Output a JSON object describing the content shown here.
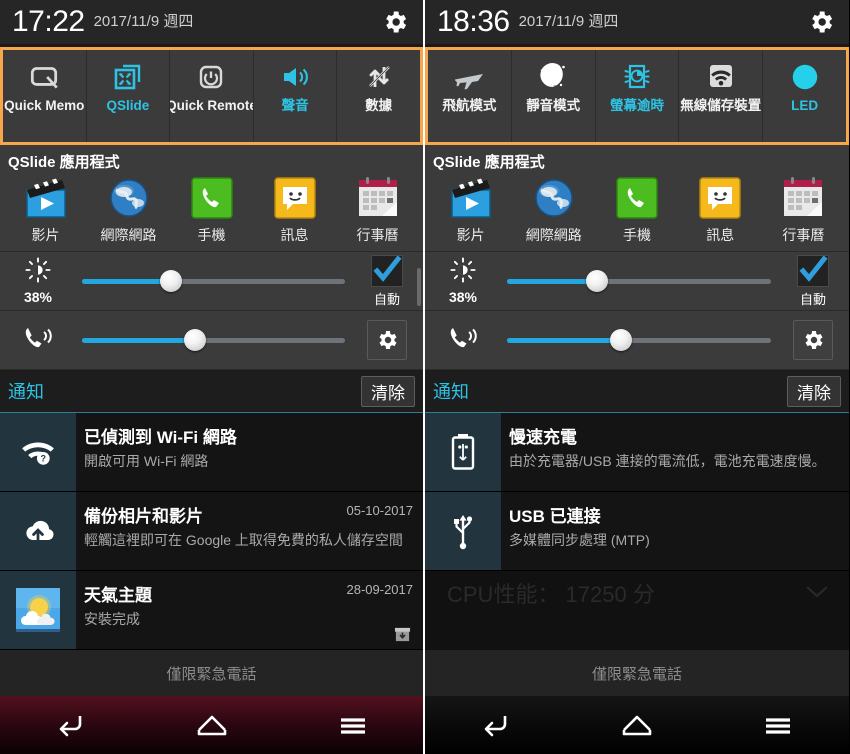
{
  "panels": [
    {
      "id": "left",
      "status": {
        "time": "17:22",
        "date": "2017/11/9 週四",
        "settings_icon": "gear-icon"
      },
      "toggles": [
        {
          "label": "Quick Memo",
          "icon": "quickmemo-icon",
          "active": false
        },
        {
          "label": "QSlide",
          "icon": "qslide-icon",
          "active": true
        },
        {
          "label": "Quick Remote",
          "icon": "quickremote-power-icon",
          "active": false
        },
        {
          "label": "聲音",
          "icon": "sound-speaker-icon",
          "active": true
        },
        {
          "label": "數據",
          "icon": "mobile-data-off-icon",
          "active": false
        }
      ],
      "qslide": {
        "title": "QSlide 應用程式",
        "apps": [
          {
            "label": "影片",
            "icon": "video-app-icon"
          },
          {
            "label": "網際網路",
            "icon": "internet-browser-icon"
          },
          {
            "label": "手機",
            "icon": "phone-app-icon"
          },
          {
            "label": "訊息",
            "icon": "messaging-app-icon"
          },
          {
            "label": "行事曆",
            "icon": "calendar-app-icon"
          }
        ]
      },
      "brightness": {
        "icon": "brightness-sun-icon",
        "percent": "38%",
        "value": 38,
        "auto_label": "自動",
        "auto_checked": true,
        "check_icon": "checkmark-icon"
      },
      "volume": {
        "icon": "ringer-volume-icon",
        "value": 43,
        "settings_icon": "gear-icon"
      },
      "notifications_header": {
        "title": "通知",
        "clear_label": "清除"
      },
      "notifications": [
        {
          "icon": "wifi-question-icon",
          "title": "已偵測到 Wi-Fi 網路",
          "subtitle": "開啟可用 Wi-Fi 網路",
          "date": "",
          "action_icon": ""
        },
        {
          "icon": "cloud-upload-icon",
          "title": "備份相片和影片",
          "subtitle": "輕觸這裡即可在 Google 上取得免費的私人儲存空間",
          "date": "05-10-2017",
          "action_icon": ""
        },
        {
          "icon": "weather-theme-icon",
          "title": "天氣主題",
          "subtitle": "安裝完成",
          "date": "28-09-2017",
          "action_icon": "download-box-icon"
        }
      ],
      "ghost_text": "",
      "emergency": "僅限緊急電話",
      "navbar": {
        "style": "red",
        "back_icon": "back-arrow-icon",
        "home_icon": "home-icon",
        "menu_icon": "menu-icon"
      }
    },
    {
      "id": "right",
      "status": {
        "time": "18:36",
        "date": "2017/11/9 週四",
        "settings_icon": "gear-icon"
      },
      "toggles": [
        {
          "label": "飛航模式",
          "icon": "airplane-icon",
          "active": false
        },
        {
          "label": "靜音模式",
          "icon": "moon-silent-icon",
          "active": false
        },
        {
          "label": "螢幕逾時",
          "icon": "screen-timeout-icon",
          "active": true
        },
        {
          "label": "無線儲存裝置",
          "icon": "wireless-storage-icon",
          "active": false
        },
        {
          "label": "LED",
          "icon": "led-circle-icon",
          "active": true
        }
      ],
      "qslide": {
        "title": "QSlide 應用程式",
        "apps": [
          {
            "label": "影片",
            "icon": "video-app-icon"
          },
          {
            "label": "網際網路",
            "icon": "internet-browser-icon"
          },
          {
            "label": "手機",
            "icon": "phone-app-icon"
          },
          {
            "label": "訊息",
            "icon": "messaging-app-icon"
          },
          {
            "label": "行事曆",
            "icon": "calendar-app-icon"
          }
        ]
      },
      "brightness": {
        "icon": "brightness-sun-icon",
        "percent": "38%",
        "value": 38,
        "auto_label": "自動",
        "auto_checked": true,
        "check_icon": "checkmark-icon"
      },
      "volume": {
        "icon": "ringer-volume-icon",
        "value": 43,
        "settings_icon": "gear-icon"
      },
      "notifications_header": {
        "title": "通知",
        "clear_label": "清除"
      },
      "notifications": [
        {
          "icon": "battery-usb-icon",
          "title": "慢速充電",
          "subtitle": "由於充電器/USB 連接的電流低，電池充電速度慢。",
          "date": "",
          "action_icon": ""
        },
        {
          "icon": "usb-icon",
          "title": "USB 已連接",
          "subtitle": "多媒體同步處理 (MTP)",
          "date": "",
          "action_icon": ""
        }
      ],
      "ghost_text": "CPU性能： 17250 分",
      "emergency": "僅限緊急電話",
      "navbar": {
        "style": "blk",
        "back_icon": "back-arrow-icon",
        "home_icon": "home-icon",
        "menu_icon": "menu-icon"
      }
    }
  ],
  "colors": {
    "accent_cyan": "#2ec3e4",
    "highlight_orange": "#f7a64b",
    "slider_blue": "#22a7e0",
    "panel_gray": "#3b3b3b",
    "notification_bg": "#141414",
    "notification_icon_bg": "#22343d"
  }
}
